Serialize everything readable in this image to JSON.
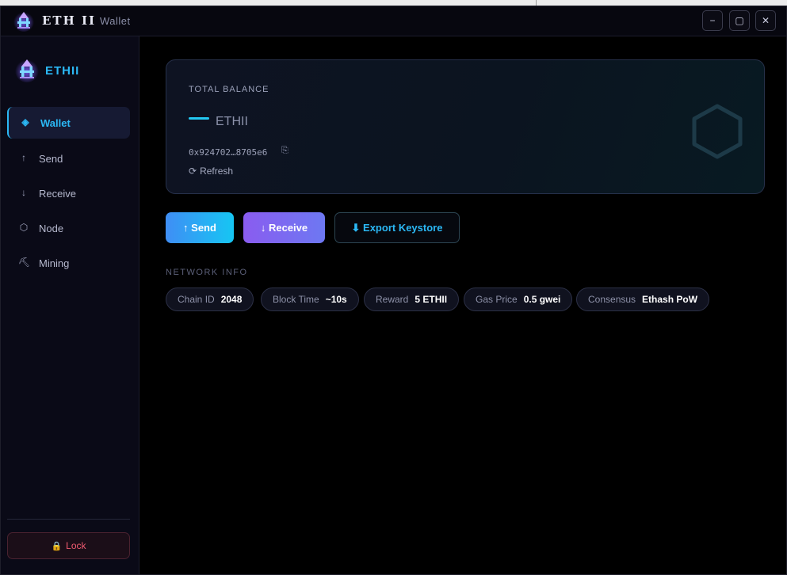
{
  "window": {
    "title": "ETH II",
    "subtitle": "Wallet",
    "controls": {
      "minimize": "−",
      "maximize": "▢",
      "close": "✕"
    }
  },
  "sidebar": {
    "brand": "ETHII",
    "items": [
      {
        "icon": "◈",
        "label": "Wallet",
        "active": true
      },
      {
        "icon": "↑",
        "label": "Send"
      },
      {
        "icon": "↓",
        "label": "Receive"
      },
      {
        "icon": "⬡",
        "label": "Node"
      },
      {
        "icon": "⛏",
        "label": "Mining"
      }
    ],
    "lock": {
      "icon": "🔒",
      "label": "Lock"
    }
  },
  "balance": {
    "label": "TOTAL BALANCE",
    "unit": "ETHII",
    "address": "0x924702…8705e6",
    "copy_icon": "⎘",
    "refresh_icon": "⟳",
    "refresh_label": "Refresh"
  },
  "actions": {
    "send": "↑ Send",
    "receive": "↓ Receive",
    "export": "⬇ Export Keystore"
  },
  "network": {
    "title": "NETWORK INFO",
    "items": [
      {
        "key": "Chain ID",
        "value": "2048"
      },
      {
        "key": "Block Time",
        "value": "~10s"
      },
      {
        "key": "Reward",
        "value": "5 ETHII"
      },
      {
        "key": "Gas Price",
        "value": "0.5 gwei"
      },
      {
        "key": "Consensus",
        "value": "Ethash PoW"
      }
    ]
  },
  "colors": {
    "accent": "#2bb8f5",
    "send_gradient": [
      "#3f8ef5",
      "#16c6f3"
    ],
    "receive_gradient": [
      "#8a5cf0",
      "#6d78f2"
    ],
    "lock": "#f05a70"
  }
}
